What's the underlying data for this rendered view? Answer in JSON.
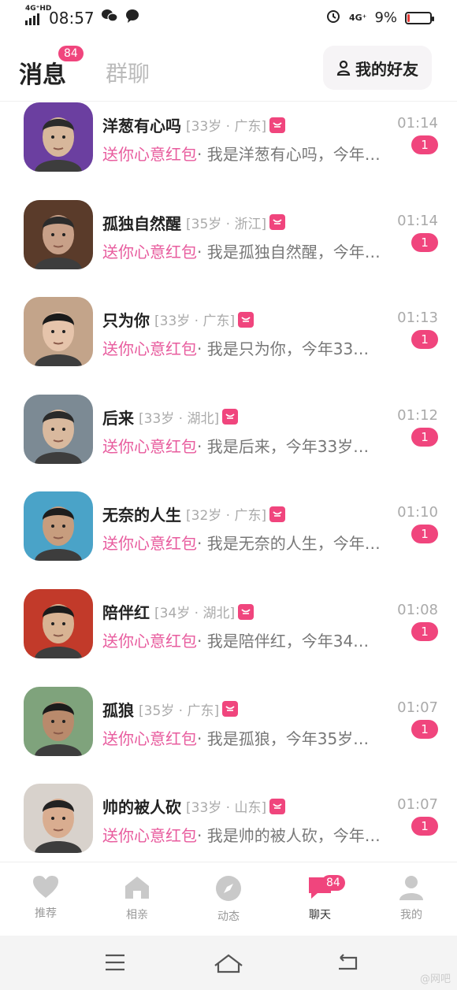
{
  "status": {
    "network": "4G⁺HD",
    "time": "08:57",
    "right_network": "4G⁺",
    "battery": "9%",
    "battery_level": 0.09
  },
  "header": {
    "tab_messages": "消息",
    "messages_badge": "84",
    "tab_groups": "群聊",
    "friends_button": "我的好友"
  },
  "messages": [
    {
      "name": "洋葱有心吗",
      "meta": "[33岁 · 广东]",
      "time": "01:14",
      "gift": "送你心意红包",
      "preview": "· 我是洋葱有心吗，今年…",
      "badge": "1"
    },
    {
      "name": "孤独自然醒",
      "meta": "[35岁 · 浙江]",
      "time": "01:14",
      "gift": "送你心意红包",
      "preview": "· 我是孤独自然醒，今年…",
      "badge": "1"
    },
    {
      "name": "只为你",
      "meta": "[33岁 · 广东]",
      "time": "01:13",
      "gift": "送你心意红包",
      "preview": "· 我是只为你，今年33…",
      "badge": "1"
    },
    {
      "name": "后来",
      "meta": "[33岁 · 湖北]",
      "time": "01:12",
      "gift": "送你心意红包",
      "preview": "· 我是后来，今年33岁…",
      "badge": "1"
    },
    {
      "name": "无奈的人生",
      "meta": "[32岁 · 广东]",
      "time": "01:10",
      "gift": "送你心意红包",
      "preview": "· 我是无奈的人生，今年…",
      "badge": "1"
    },
    {
      "name": "陪伴红",
      "meta": "[34岁 · 湖北]",
      "time": "01:08",
      "gift": "送你心意红包",
      "preview": "· 我是陪伴红，今年34…",
      "badge": "1"
    },
    {
      "name": "孤狼",
      "meta": "[35岁 · 广东]",
      "time": "01:07",
      "gift": "送你心意红包",
      "preview": "· 我是孤狼，今年35岁…",
      "badge": "1"
    },
    {
      "name": "帅的被人砍",
      "meta": "[33岁 · 山东]",
      "time": "01:07",
      "gift": "送你心意红包",
      "preview": "· 我是帅的被人砍，今年…",
      "badge": "1"
    }
  ],
  "nav": {
    "recommend": "推荐",
    "dating": "相亲",
    "moments": "动态",
    "chat": "聊天",
    "chat_badge": "84",
    "me": "我的"
  },
  "watermark": "@网吧",
  "colors": {
    "accent": "#f0457d",
    "gift_text": "#e85c9e"
  }
}
